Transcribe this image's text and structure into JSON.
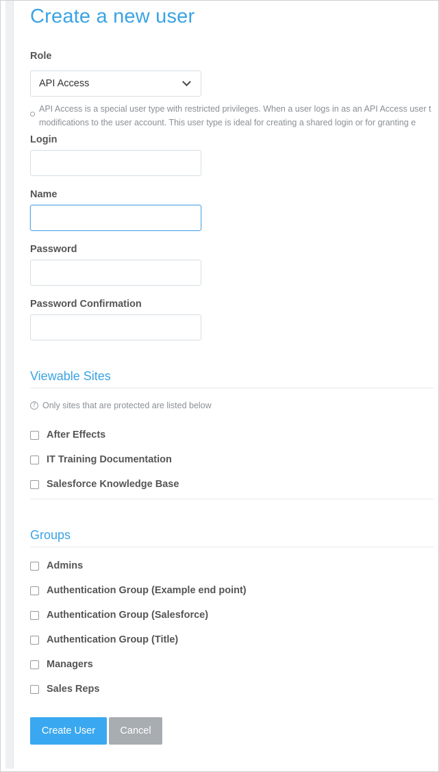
{
  "page": {
    "title": "Create a new user"
  },
  "role": {
    "label": "Role",
    "selected": "API Access",
    "help_line1": "API Access is a special user type with restricted privileges. When a user logs in as an API Access user t",
    "help_line2": "modifications to the user account. This user type is ideal for creating a shared login or for granting e"
  },
  "fields": {
    "login_label": "Login",
    "login_value": "",
    "name_label": "Name",
    "name_value": "",
    "password_label": "Password",
    "password_value": "",
    "password_confirm_label": "Password Confirmation",
    "password_confirm_value": ""
  },
  "viewable_sites": {
    "title": "Viewable Sites",
    "note": "Only sites that are protected are listed below",
    "items": [
      {
        "label": "After Effects",
        "checked": false
      },
      {
        "label": "IT Training Documentation",
        "checked": false
      },
      {
        "label": "Salesforce Knowledge Base",
        "checked": false
      }
    ]
  },
  "groups": {
    "title": "Groups",
    "items": [
      {
        "label": "Admins",
        "checked": false
      },
      {
        "label": "Authentication Group (Example end point)",
        "checked": false
      },
      {
        "label": "Authentication Group (Salesforce)",
        "checked": false
      },
      {
        "label": "Authentication Group (Title)",
        "checked": false
      },
      {
        "label": "Managers",
        "checked": false
      },
      {
        "label": "Sales Reps",
        "checked": false
      }
    ]
  },
  "actions": {
    "create_label": "Create User",
    "cancel_label": "Cancel"
  },
  "colors": {
    "accent": "#3aa3e3",
    "primary_button": "#3aa8f0",
    "cancel_button": "#a8adb2"
  },
  "icons": {
    "select_caret": "chevron-down-icon",
    "help": "info-icon",
    "note": "question-circle-icon"
  }
}
